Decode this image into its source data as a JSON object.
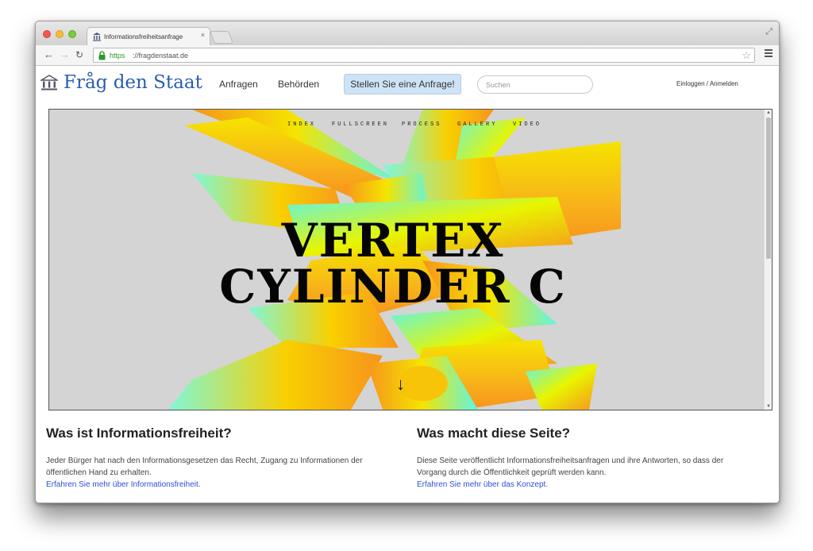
{
  "browser": {
    "tab_title": "Informationsfreiheitsanfrage",
    "tab_close": "×",
    "url_scheme": "https",
    "url_rest": "://fragdenstaat.de"
  },
  "site": {
    "logo_text": "Fråg den Staat",
    "nav": {
      "anfragen": "Anfragen",
      "behoerden": "Behörden",
      "cta": "Stellen Sie eine Anfrage!",
      "search_placeholder": "Suchen",
      "login": "Einloggen / Anmelden"
    }
  },
  "hero": {
    "menu": [
      "INDEX",
      "FULLSCREEN",
      "PROCESS",
      "GALLERY",
      "VIDEO"
    ],
    "title_line1": "VERTEX",
    "title_line2": "CYLINDER C",
    "scroll_arrow": "↓",
    "colors": {
      "background": "#d4d4d4",
      "orange": "#f7941d",
      "yellow": "#f5e400",
      "cyan": "#5ff5e6"
    }
  },
  "info": {
    "left": {
      "heading": "Was ist Informationsfreiheit?",
      "body": "Jeder Bürger hat nach den Informationsgesetzen das Recht, Zugang zu Informationen der öffentlichen Hand zu erhalten.",
      "link": "Erfahren Sie mehr über Informationsfreiheit."
    },
    "right": {
      "heading": "Was macht diese Seite?",
      "body": "Diese Seite veröffentlicht Informationsfreiheitsanfragen und ihre Antworten, so dass der Vorgang durch die Öffentlichkeit geprüft werden kann.",
      "link": "Erfahren Sie mehr über das Konzept."
    }
  }
}
